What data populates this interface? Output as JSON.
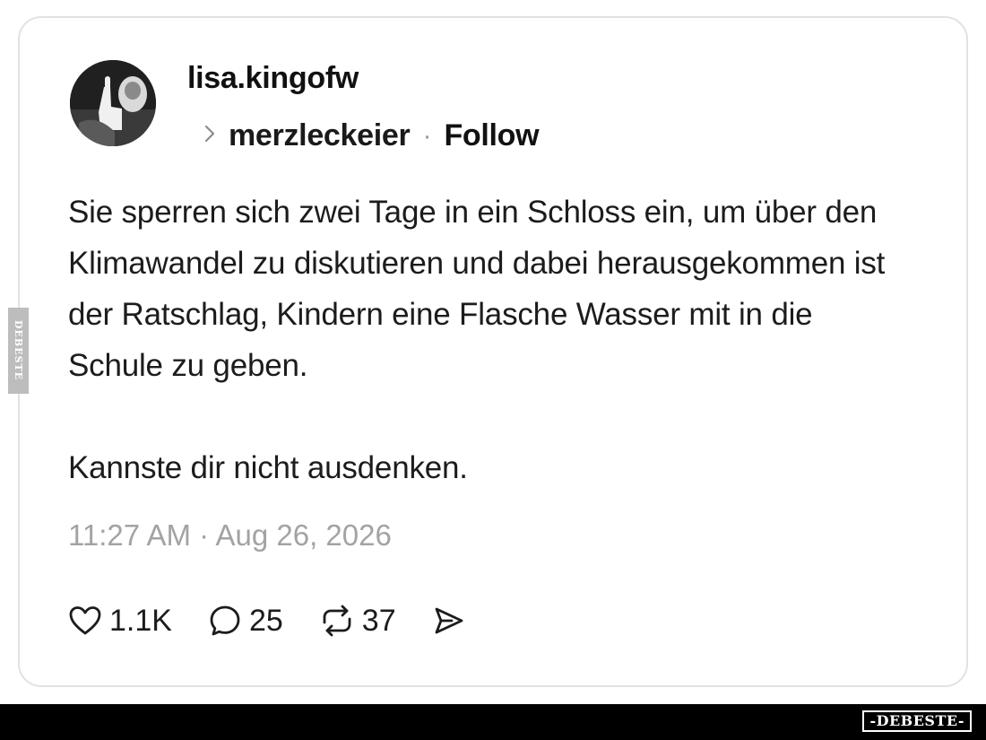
{
  "post": {
    "username": "lisa.kingofw",
    "reply_to": "merzleckeier",
    "separator": "·",
    "follow_label": "Follow",
    "text_paragraph_1": "Sie sperren sich zwei Tage in ein Schloss ein, um über den Klimawandel zu diskutieren und dabei herausgekommen ist der Ratschlag, Kindern eine Flasche Wasser mit in die Schule zu geben.",
    "text_paragraph_2": "Kannste dir nicht ausdenken.",
    "timestamp": "11:27 AM · Aug 26, 2026"
  },
  "actions": {
    "likes": "1.1K",
    "replies": "25",
    "reposts": "37",
    "like_icon": "heart-icon",
    "reply_icon": "speech-bubble-icon",
    "repost_icon": "repost-arrows-icon",
    "share_icon": "send-icon"
  },
  "watermark": {
    "side": "DEBESTE",
    "bottom": "-DEBESTE-"
  },
  "colors": {
    "text": "#111111",
    "muted": "#a3a3a3",
    "card_border": "#e2e2e2",
    "bottom_bar": "#000000"
  }
}
